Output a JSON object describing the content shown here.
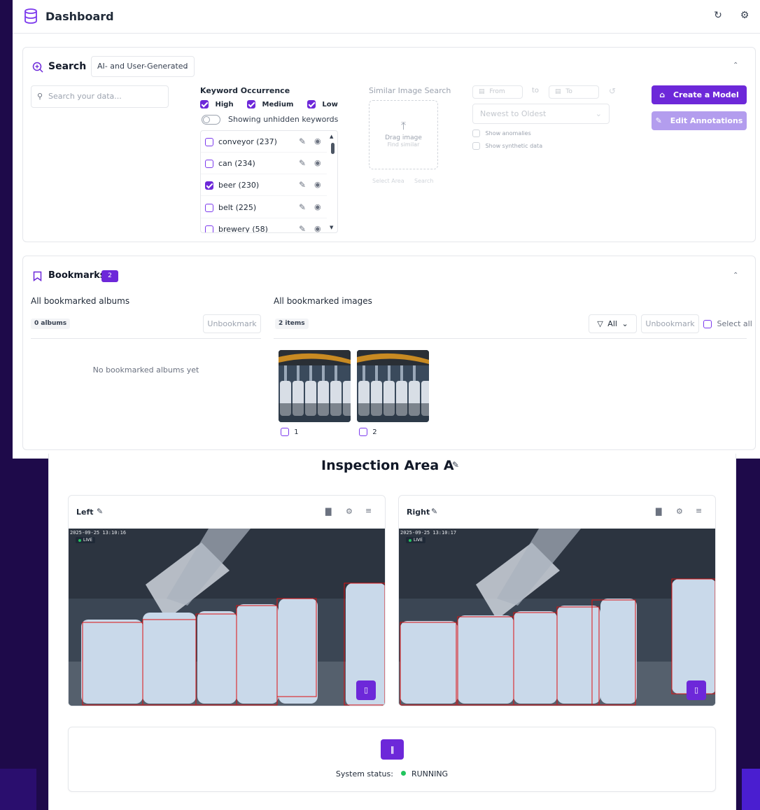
{
  "app": {
    "title": "Dashboard"
  },
  "search": {
    "title": "Search",
    "mode_select": "AI- and User-Generated",
    "placeholder": "Search your data...",
    "keyword_title": "Keyword Occurrence",
    "levels": [
      {
        "label": "High",
        "checked": true
      },
      {
        "label": "Medium",
        "checked": true
      },
      {
        "label": "Low",
        "checked": true
      }
    ],
    "toggle_label": "Showing unhidden keywords",
    "keywords": [
      {
        "label": "conveyor (237)",
        "checked": false
      },
      {
        "label": "can (234)",
        "checked": false
      },
      {
        "label": "beer (230)",
        "checked": true
      },
      {
        "label": "belt (225)",
        "checked": false
      },
      {
        "label": "brewery (58)",
        "checked": false
      }
    ],
    "similar_title": "Similar Image Search",
    "drag_label": "Drag image",
    "find_similar": "Find similar",
    "select_area": "Select Area",
    "search_link": "Search",
    "from_placeholder": "From",
    "to_word": "to",
    "to_placeholder": "To",
    "sort_select": "Newest to Oldest",
    "show_anomalies": "Show anomalies",
    "show_synthetic": "Show synthetic data",
    "create_model": "Create a Model",
    "edit_annotations": "Edit Annotations"
  },
  "bookmarks": {
    "title": "Bookmarks",
    "count": "2",
    "albums_title": "All bookmarked albums",
    "albums_tag": "0 albums",
    "albums_unbookmark": "Unbookmark",
    "albums_empty": "No bookmarked albums yet",
    "images_title": "All bookmarked images",
    "images_tag": "2 items",
    "filter_label": "All",
    "images_unbookmark": "Unbookmark",
    "select_all": "Select all",
    "images": [
      {
        "label": "1"
      },
      {
        "label": "2"
      }
    ]
  },
  "inspection": {
    "title": "Inspection Area A",
    "cameras": [
      {
        "name": "Left",
        "timestamp": "2025-09-25 13:10:16",
        "live": "LIVE"
      },
      {
        "name": "Right",
        "timestamp": "2025-09-25 13:10:17",
        "live": "LIVE"
      }
    ],
    "status_label": "System status:",
    "status_value": "RUNNING",
    "status_color": "#22c55e",
    "accent": "#6d28d9"
  }
}
